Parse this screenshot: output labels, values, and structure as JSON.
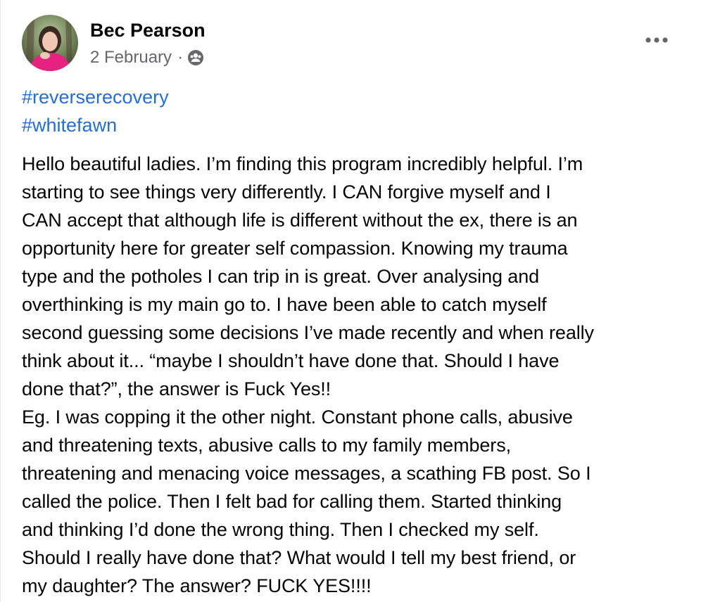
{
  "post": {
    "author": "Bec Pearson",
    "date": "2 February",
    "separator": "·",
    "audience_icon": "group-audience-icon",
    "more_icon": "more-options-icon",
    "hashtags": [
      "#reverserecovery",
      "#whitefawn"
    ],
    "lines": [
      "Hello beautiful ladies. I’m finding this program incredibly helpful. I’m",
      "starting to see things very differently. I CAN forgive myself and I",
      "CAN accept that although life is different without the ex, there is an",
      "opportunity here for greater self compassion. Knowing my trauma",
      "type and the potholes I can trip in is great. Over analysing and",
      "overthinking is my main go to. I have been able to catch myself",
      "second guessing some decisions I’ve made recently and when really",
      "think about it... “maybe I shouldn’t have done that. Should I have",
      "done that?”, the answer is Fuck Yes!!",
      "Eg. I was copping it the other night. Constant phone calls, abusive",
      "and threatening texts, abusive calls to my family members,",
      "threatening and menacing voice messages, a scathing FB post. So I",
      "called the police. Then I felt bad for calling them. Started thinking",
      "and thinking I’d done the wrong thing. Then I checked my self.",
      "Should I really have done that? What would I tell my best friend, or",
      "my daughter? The answer? FUCK YES!!!!"
    ]
  },
  "colors": {
    "link": "#216fdb",
    "text": "#050505",
    "secondary": "#65676b"
  }
}
